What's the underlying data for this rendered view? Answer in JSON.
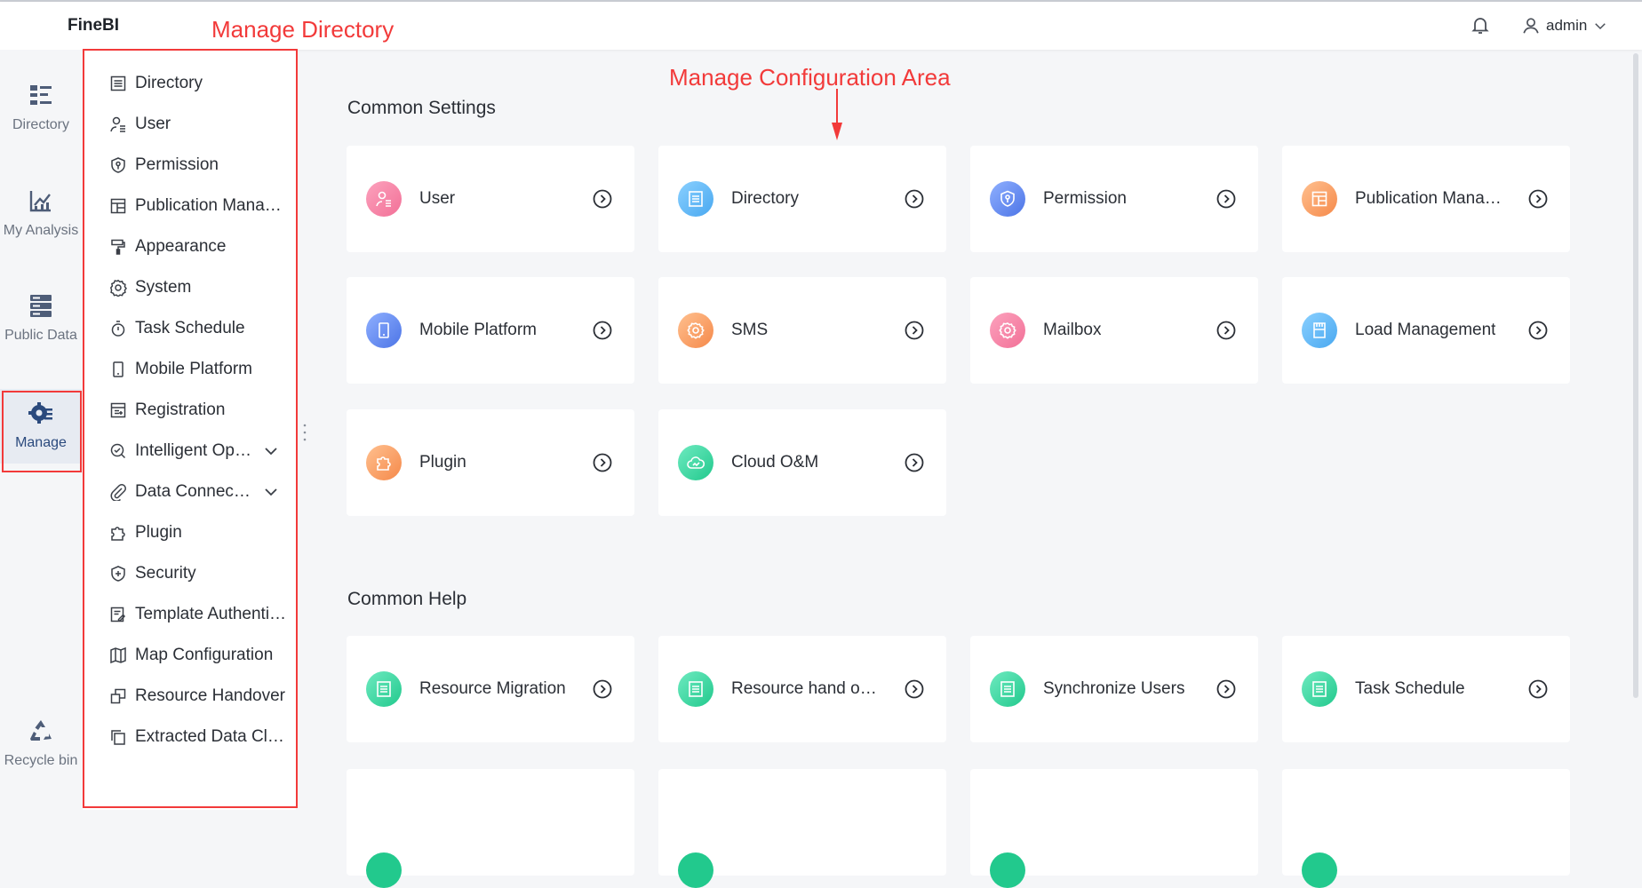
{
  "app": {
    "logo": "FineBI"
  },
  "header": {
    "username": "admin"
  },
  "rail": [
    {
      "label": "Directory",
      "icon": "directory-icon"
    },
    {
      "label": "My Analysis",
      "icon": "analysis-chart-icon"
    },
    {
      "label": "Public Data",
      "icon": "database-icon"
    },
    {
      "label": "Manage",
      "icon": "manage-gear-icon",
      "active": true
    },
    {
      "label": "Recycle bin",
      "icon": "recycle-icon"
    }
  ],
  "menu": [
    {
      "label": "Directory"
    },
    {
      "label": "User"
    },
    {
      "label": "Permission"
    },
    {
      "label": "Publication Management"
    },
    {
      "label": "Appearance"
    },
    {
      "label": "System"
    },
    {
      "label": "Task Schedule"
    },
    {
      "label": "Mobile Platform"
    },
    {
      "label": "Registration"
    },
    {
      "label": "Intelligent Operation",
      "expandable": true
    },
    {
      "label": "Data Connection",
      "expandable": true
    },
    {
      "label": "Plugin"
    },
    {
      "label": "Security"
    },
    {
      "label": "Template Authentication"
    },
    {
      "label": "Map Configuration"
    },
    {
      "label": "Resource Handover"
    },
    {
      "label": "Extracted Data Clear"
    }
  ],
  "sections": {
    "settings_title": "Common Settings",
    "help_title": "Common Help"
  },
  "settings_cards": [
    {
      "label": "User",
      "color": "#f786a8"
    },
    {
      "label": "Directory",
      "color": "#58b4f5"
    },
    {
      "label": "Permission",
      "color": "#5a84f0"
    },
    {
      "label": "Publication Management",
      "color": "#f8a067"
    },
    {
      "label": "Mobile Platform",
      "color": "#5a84f0"
    },
    {
      "label": "SMS",
      "color": "#f8a067"
    },
    {
      "label": "Mailbox",
      "color": "#f786a8"
    },
    {
      "label": "Load Management",
      "color": "#58b4f5"
    },
    {
      "label": "Plugin",
      "color": "#f8a067"
    },
    {
      "label": "Cloud O&M",
      "color": "#3dd6a0"
    }
  ],
  "help_cards": [
    {
      "label": "Resource Migration",
      "color": "#3dd6a0"
    },
    {
      "label": "Resource hand over",
      "color": "#3dd6a0"
    },
    {
      "label": "Synchronize Users",
      "color": "#3dd6a0"
    },
    {
      "label": "Task Schedule",
      "color": "#3dd6a0"
    }
  ],
  "annotations": {
    "manage_directory": "Manage Directory",
    "config_area": "Manage  Configuration Area",
    "color": "#f23a3a"
  }
}
